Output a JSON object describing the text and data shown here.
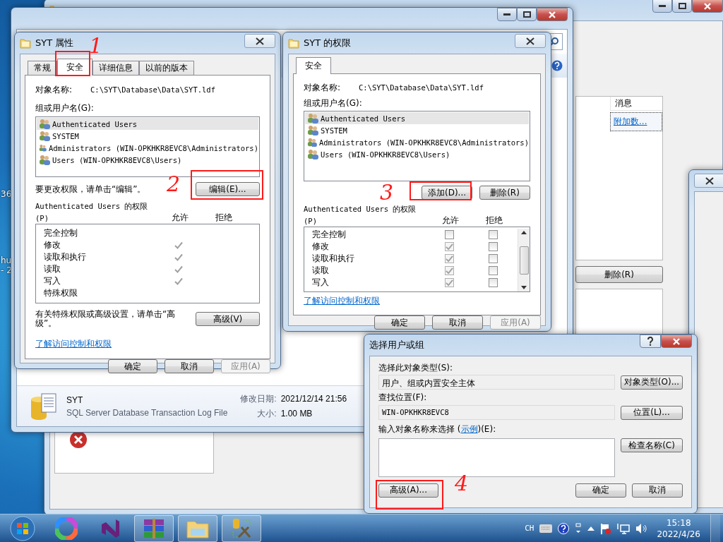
{
  "desktop": {
    "labels": [
      "36",
      "hu",
      "- 2"
    ]
  },
  "attach_window": {
    "column": "消息",
    "link": "附加数...",
    "button": "删除(R)"
  },
  "explorer": {
    "details": {
      "name": "SYT",
      "type": "SQL Server Database Transaction Log File",
      "modified_label": "修改日期:",
      "modified": "2021/12/14 21:56",
      "size_label": "大小:",
      "size": "1.00 MB"
    }
  },
  "properties_dialog": {
    "title": "SYT 属性",
    "tabs": [
      {
        "label": "常规",
        "selected": false
      },
      {
        "label": "安全",
        "selected": true
      },
      {
        "label": "详细信息",
        "selected": false
      },
      {
        "label": "以前的版本",
        "selected": false
      }
    ],
    "object_label": "对象名称:",
    "object_path": "C:\\SYT\\Database\\Data\\SYT.ldf",
    "group_label": "组或用户名(G):",
    "users": [
      {
        "name": "Authenticated Users",
        "selected": true
      },
      {
        "name": "SYSTEM",
        "selected": false
      },
      {
        "name": "Administrators (WIN-OPKHKR8EVC8\\Administrators)",
        "selected": false
      },
      {
        "name": "Users (WIN-OPKHKR8EVC8\\Users)",
        "selected": false
      }
    ],
    "edit_hint": "要更改权限，请单击“编辑”。",
    "edit_button": "编辑(E)...",
    "permissions_label": "Authenticated Users 的权限",
    "permissions_key": "(P)",
    "allow_header": "允许",
    "deny_header": "拒绝",
    "permissions": [
      {
        "name": "完全控制",
        "allow": false,
        "deny": false
      },
      {
        "name": "修改",
        "allow": true,
        "deny": false
      },
      {
        "name": "读取和执行",
        "allow": true,
        "deny": false
      },
      {
        "name": "读取",
        "allow": true,
        "deny": false
      },
      {
        "name": "写入",
        "allow": true,
        "deny": false
      },
      {
        "name": "特殊权限",
        "allow": false,
        "deny": false
      }
    ],
    "advanced_hint": "有关特殊权限或高级设置，请单击“高级”。",
    "advanced_button": "高级(V)",
    "link": "了解访问控制和权限",
    "buttons": [
      {
        "label": "确定",
        "disabled": false
      },
      {
        "label": "取消",
        "disabled": false
      },
      {
        "label": "应用(A)",
        "disabled": true
      }
    ]
  },
  "permissions_dialog": {
    "title": "SYT 的权限",
    "tabs": [
      {
        "label": "安全",
        "selected": true
      }
    ],
    "object_label": "对象名称:",
    "object_path": "C:\\SYT\\Database\\Data\\SYT.ldf",
    "group_label": "组或用户名(G):",
    "users": [
      {
        "name": "Authenticated Users",
        "selected": true
      },
      {
        "name": "SYSTEM",
        "selected": false
      },
      {
        "name": "Administrators (WIN-OPKHKR8EVC8\\Administrators)",
        "selected": false
      },
      {
        "name": "Users (WIN-OPKHKR8EVC8\\Users)",
        "selected": false
      }
    ],
    "add_button": "添加(D)...",
    "remove_button": "删除(R)",
    "permissions_label": "Authenticated Users 的权限",
    "permissions_key": "(P)",
    "allow_header": "允许",
    "deny_header": "拒绝",
    "permissions": [
      {
        "name": "完全控制",
        "allow": false,
        "deny": false
      },
      {
        "name": "修改",
        "allow": true,
        "deny": false
      },
      {
        "name": "读取和执行",
        "allow": true,
        "deny": false
      },
      {
        "name": "读取",
        "allow": true,
        "deny": false
      },
      {
        "name": "写入",
        "allow": true,
        "deny": false
      }
    ],
    "link": "了解访问控制和权限",
    "buttons": [
      {
        "label": "确定",
        "disabled": false
      },
      {
        "label": "取消",
        "disabled": false
      },
      {
        "label": "应用(A)",
        "disabled": true
      }
    ]
  },
  "select_dialog": {
    "title": "选择用户或组",
    "object_type_label": "选择此对象类型(S):",
    "object_type_value": "用户、组或内置安全主体",
    "object_types_button": "对象类型(O)...",
    "location_label": "查找位置(F):",
    "location_value": "WIN-OPKHKR8EVC8",
    "location_button": "位置(L)...",
    "enter_label_before": "输入对象名称来选择 (",
    "enter_link": "示例",
    "enter_label_after": ")(E):",
    "check_names_button": "检查名称(C)",
    "advanced_button": "高级(A)...",
    "ok_button": "确定",
    "cancel_button": "取消"
  },
  "annotations": [
    {
      "number": "1"
    },
    {
      "number": "2"
    },
    {
      "number": "3"
    },
    {
      "number": "4"
    }
  ],
  "taskbar": {
    "language": "CH",
    "time": "15:18",
    "date": "2022/4/26"
  }
}
